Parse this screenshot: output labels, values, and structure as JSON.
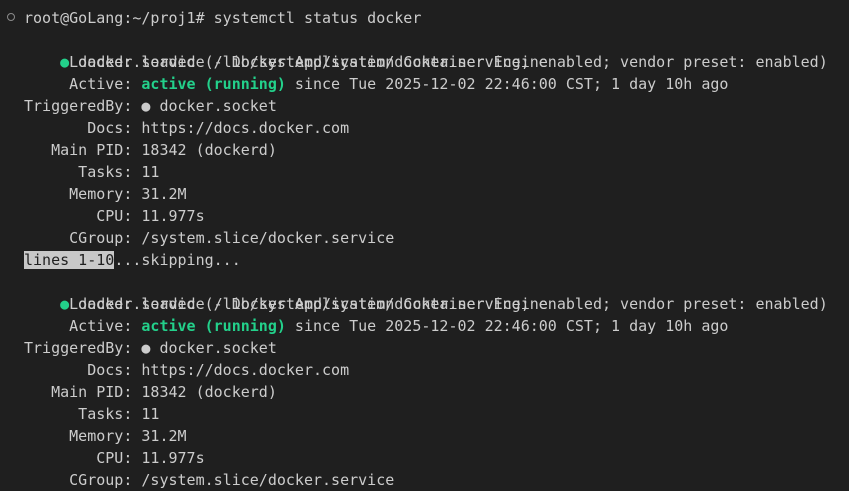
{
  "prompt": {
    "text": "root@GoLang:~/proj1# systemctl status docker"
  },
  "pager": {
    "marker": "lines 1-10",
    "rest": "...skipping..."
  },
  "blocks": [
    {
      "dot": "●",
      "header": " docker.service - Docker Application Container Engine",
      "loaded_label": "     Loaded: ",
      "loaded_value": "loaded (/lib/systemd/system/docker.service; enabled; vendor preset: enabled)",
      "active_label": "     Active: ",
      "active_state": "active (running)",
      "active_rest": " since Tue 2025-12-02 22:46:00 CST; 1 day 10h ago",
      "triggered_label": "TriggeredBy: ",
      "triggered_dot": "●",
      "triggered_value": " docker.socket",
      "docs_label": "       Docs: ",
      "docs_value": "https://docs.docker.com",
      "pid_label": "   Main PID: ",
      "pid_value": "18342 (dockerd)",
      "tasks_label": "      Tasks: ",
      "tasks_value": "11",
      "memory_label": "     Memory: ",
      "memory_value": "31.2M",
      "cpu_label": "        CPU: ",
      "cpu_value": "11.977s",
      "cgroup_label": "     CGroup: ",
      "cgroup_value": "/system.slice/docker.service"
    },
    {
      "dot": "●",
      "header": " docker.service - Docker Application Container Engine",
      "loaded_label": "     Loaded: ",
      "loaded_value": "loaded (/lib/systemd/system/docker.service; enabled; vendor preset: enabled)",
      "active_label": "     Active: ",
      "active_state": "active (running)",
      "active_rest": " since Tue 2025-12-02 22:46:00 CST; 1 day 10h ago",
      "triggered_label": "TriggeredBy: ",
      "triggered_dot": "●",
      "triggered_value": " docker.socket",
      "docs_label": "       Docs: ",
      "docs_value": "https://docs.docker.com",
      "pid_label": "   Main PID: ",
      "pid_value": "18342 (dockerd)",
      "tasks_label": "      Tasks: ",
      "tasks_value": "11",
      "memory_label": "     Memory: ",
      "memory_value": "31.2M",
      "cpu_label": "        CPU: ",
      "cpu_value": "11.977s",
      "cgroup_label": "     CGroup: ",
      "cgroup_value": "/system.slice/docker.service"
    }
  ]
}
